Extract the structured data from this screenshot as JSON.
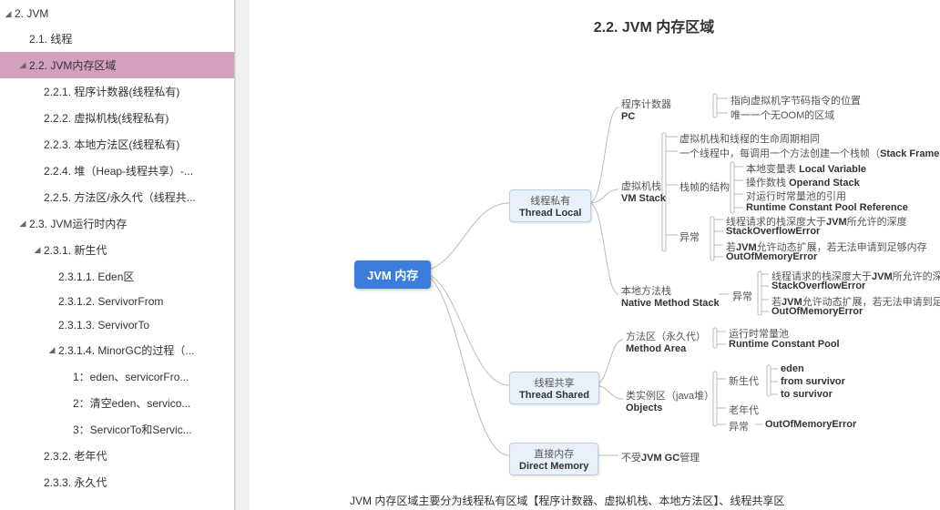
{
  "sidebar": {
    "items": [
      {
        "label": "2. JVM",
        "level": 0,
        "arrow": "down",
        "selected": false
      },
      {
        "label": "2.1. 线程",
        "level": 1,
        "arrow": "",
        "selected": false
      },
      {
        "label": "2.2. JVM内存区域",
        "level": 1,
        "arrow": "down",
        "selected": true
      },
      {
        "label": "2.2.1. 程序计数器(线程私有)",
        "level": 2,
        "arrow": "",
        "selected": false
      },
      {
        "label": "2.2.2. 虚拟机栈(线程私有)",
        "level": 2,
        "arrow": "",
        "selected": false
      },
      {
        "label": "2.2.3. 本地方法区(线程私有)",
        "level": 2,
        "arrow": "",
        "selected": false
      },
      {
        "label": "2.2.4. 堆（Heap-线程共享）-...",
        "level": 2,
        "arrow": "",
        "selected": false
      },
      {
        "label": "2.2.5. 方法区/永久代（线程共...",
        "level": 2,
        "arrow": "",
        "selected": false
      },
      {
        "label": "2.3. JVM运行时内存",
        "level": 1,
        "arrow": "down",
        "selected": false
      },
      {
        "label": "2.3.1. 新生代",
        "level": 2,
        "arrow": "down",
        "selected": false
      },
      {
        "label": "2.3.1.1. Eden区",
        "level": 3,
        "arrow": "",
        "selected": false
      },
      {
        "label": "2.3.1.2. ServivorFrom",
        "level": 3,
        "arrow": "",
        "selected": false
      },
      {
        "label": "2.3.1.3. ServivorTo",
        "level": 3,
        "arrow": "",
        "selected": false
      },
      {
        "label": "2.3.1.4.  MinorGC的过程（...",
        "level": 3,
        "arrow": "down",
        "selected": false
      },
      {
        "label": "1：eden、servicorFro...",
        "level": 4,
        "arrow": "",
        "selected": false
      },
      {
        "label": "2：清空eden、servico...",
        "level": 4,
        "arrow": "",
        "selected": false
      },
      {
        "label": "3：ServicorTo和Servic...",
        "level": 4,
        "arrow": "",
        "selected": false
      },
      {
        "label": "2.3.2. 老年代",
        "level": 2,
        "arrow": "",
        "selected": false
      },
      {
        "label": "2.3.3. 永久代",
        "level": 2,
        "arrow": "",
        "selected": false
      }
    ]
  },
  "main": {
    "title": "2.2. JVM 内存区域",
    "footer": "JVM 内存区域主要分为线程私有区域【程序计数器、虚拟机栈、本地方法区】、线程共享区"
  },
  "mindmap": {
    "root": "JVM 内存",
    "branches": {
      "threadLocal": {
        "cn": "线程私有",
        "en": "Thread Local"
      },
      "threadShared": {
        "cn": "线程共享",
        "en": "Thread Shared"
      },
      "directMemory": {
        "cn": "直接内存",
        "en": "Direct Memory"
      }
    },
    "pc": {
      "cn": "程序计数器",
      "en": "PC",
      "d1": "指向虚拟机字节码指令的位置",
      "d2": "唯一一个无OOM的区域"
    },
    "vmstack": {
      "cn": "虚拟机栈",
      "en": "VM Stack",
      "d1": "虚拟机栈和线程的生命周期相同",
      "d2p": "一个线程中，每调用一个方法创建一个栈帧（",
      "d2b": "Stack Frame",
      "d2s": "）",
      "frame": {
        "label": "栈帧的结构",
        "i1p": "本地变量表 ",
        "i1b": "Local Variable",
        "i2p": "操作数栈 ",
        "i2b": "Operand Stack",
        "i3": "对运行时常量池的引用",
        "i4": "Runtime Constant Pool Reference"
      },
      "except": {
        "label": "异常",
        "e1p": "线程请求的栈深度大于",
        "e1b": "JVM",
        "e1s": "所允许的深度",
        "e2": "StackOverflowError",
        "e3p": "若",
        "e3b": "JVM",
        "e3s": "允许动态扩展，若无法申请到足够内存",
        "e4": "OutOfMemoryError"
      }
    },
    "native": {
      "cn": "本地方法栈",
      "en": "Native Method Stack",
      "except": {
        "label": "异常",
        "e1p": "线程请求的栈深度大于",
        "e1b": "JVM",
        "e1s": "所允许的深度",
        "e2": "StackOverflowError",
        "e3p": "若",
        "e3b": "JVM",
        "e3s": "允许动态扩展，若无法申请到足够内存",
        "e4": "OutOfMemoryError"
      }
    },
    "methodArea": {
      "cn": "方法区（永久代）",
      "en": "Method Area",
      "d1": "运行时常量池",
      "d2": "Runtime Constant Pool"
    },
    "objects": {
      "cn": "类实例区（java堆）",
      "en": "Objects",
      "young": {
        "label": "新生代",
        "i1": "eden",
        "i2": "from survivor",
        "i3": "to survivor"
      },
      "old": "老年代",
      "except": {
        "label": "异常",
        "e1": "OutOfMemoryError"
      }
    },
    "direct": {
      "d1p": "不受",
      "d1b": "JVM GC",
      "d1s": "管理"
    }
  }
}
